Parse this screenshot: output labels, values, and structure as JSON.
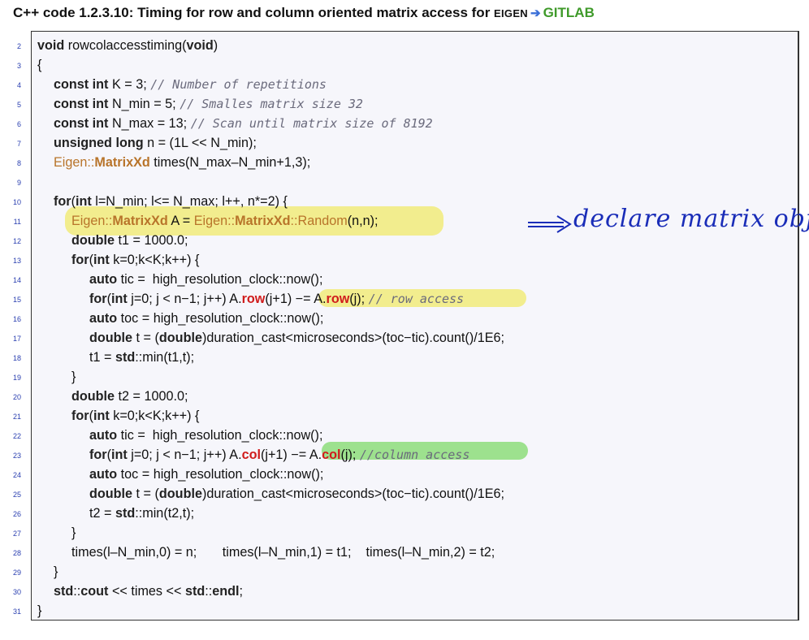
{
  "header": {
    "prefix": "C++ code 1.2.3.10: Timing for row and column oriented matrix access for ",
    "eigen": "Eigen",
    "gitlab": "GITLAB"
  },
  "annotation": {
    "text": "declare matrix obj"
  },
  "lines": [
    {
      "n": "2"
    },
    {
      "n": "3"
    },
    {
      "n": "4"
    },
    {
      "n": "5"
    },
    {
      "n": "6"
    },
    {
      "n": "7"
    },
    {
      "n": "8"
    },
    {
      "n": "9"
    },
    {
      "n": "10"
    },
    {
      "n": "11"
    },
    {
      "n": "12"
    },
    {
      "n": "13"
    },
    {
      "n": "14"
    },
    {
      "n": "15"
    },
    {
      "n": "16"
    },
    {
      "n": "17"
    },
    {
      "n": "18"
    },
    {
      "n": "19"
    },
    {
      "n": "20"
    },
    {
      "n": "21"
    },
    {
      "n": "22"
    },
    {
      "n": "23"
    },
    {
      "n": "24"
    },
    {
      "n": "25"
    },
    {
      "n": "26"
    },
    {
      "n": "27"
    },
    {
      "n": "28"
    },
    {
      "n": "29"
    },
    {
      "n": "30"
    },
    {
      "n": "31"
    }
  ],
  "code": {
    "l2_kw": "void",
    "l2_a": " rowcolaccesstiming(",
    "l2_kw2": "void",
    "l2_b": ")",
    "l3": "{",
    "l4_kw": "const int",
    "l4_a": " K = 3; ",
    "l4_cm": "// Number of repetitions",
    "l5_kw": "const int",
    "l5_a": " N_min = 5; ",
    "l5_cm": "// Smalles matrix size 32",
    "l6_kw": "const int",
    "l6_a": " N_max = 13; ",
    "l6_cm": "// Scan until matrix size of 8192",
    "l7_kw": "unsigned long",
    "l7_a": " n = (1L << N_min);",
    "l8_ei": "Eigen",
    "l8_s": "::",
    "l8_ty": "MatrixXd",
    "l8_a": " times(N_max–N_min+1,3);",
    "l9": "",
    "l10_kw": "for",
    "l10_a": "(",
    "l10_kw2": "int",
    "l10_b": " l=N_min; l<= N_max; l++, n*=2) {",
    "l11_ei": "Eigen",
    "l11_s": "::",
    "l11_ty": "MatrixXd",
    "l11_a": " A = ",
    "l11_ei2": "Eigen",
    "l11_s2": "::",
    "l11_ty2": "MatrixXd",
    "l11_s3": "::",
    "l11_ei3": "Random",
    "l11_b": "(n,n);",
    "l12_kw": "double",
    "l12_a": " t1 = 1000.0;",
    "l13_kw": "for",
    "l13_a": "(",
    "l13_kw2": "int",
    "l13_b": " k=0;k<K;k++) {",
    "l14_kw": "auto",
    "l14_a": " tic =  high_resolution_clock::now();",
    "l15_kw": "for",
    "l15_a": "(",
    "l15_kw2": "int",
    "l15_b": " j=0; j < n−1; j++) A.",
    "l15_r1": "row",
    "l15_c": "(j+1) −= A.",
    "l15_r2": "row",
    "l15_d": "(j); ",
    "l15_cm": "// row access",
    "l16_kw": "auto",
    "l16_a": " toc = high_resolution_clock::now();",
    "l17_kw": "double",
    "l17_a": " t = (",
    "l17_kw2": "double",
    "l17_b": ")duration_cast<microseconds>(toc−tic).count()/1E6;",
    "l18_a": "t1 = ",
    "l18_kw": "std",
    "l18_b": "::min(t1,t);",
    "l19": "}",
    "l20_kw": "double",
    "l20_a": " t2 = 1000.0;",
    "l21_kw": "for",
    "l21_a": "(",
    "l21_kw2": "int",
    "l21_b": " k=0;k<K;k++) {",
    "l22_kw": "auto",
    "l22_a": " tic =  high_resolution_clock::now();",
    "l23_kw": "for",
    "l23_a": "(",
    "l23_kw2": "int",
    "l23_b": " j=0; j < n−1; j++) A.",
    "l23_r1": "col",
    "l23_c": "(j+1) −= A.",
    "l23_r2": "col",
    "l23_d": "(j); ",
    "l23_cm": "//column access",
    "l24_kw": "auto",
    "l24_a": " toc = high_resolution_clock::now();",
    "l25_kw": "double",
    "l25_a": " t = (",
    "l25_kw2": "double",
    "l25_b": ")duration_cast<microseconds>(toc−tic).count()/1E6;",
    "l26_a": "t2 = ",
    "l26_kw": "std",
    "l26_b": "::min(t2,t);",
    "l27": "}",
    "l28": "times(l–N_min,0) = n;       times(l–N_min,1) = t1;    times(l–N_min,2) = t2;",
    "l29": "}",
    "l30_kw": "std",
    "l30_a": "::",
    "l30_kw2": "cout",
    "l30_b": " << times << ",
    "l30_kw3": "std",
    "l30_c": "::",
    "l30_kw4": "endl",
    "l30_d": ";",
    "l31": "}"
  }
}
